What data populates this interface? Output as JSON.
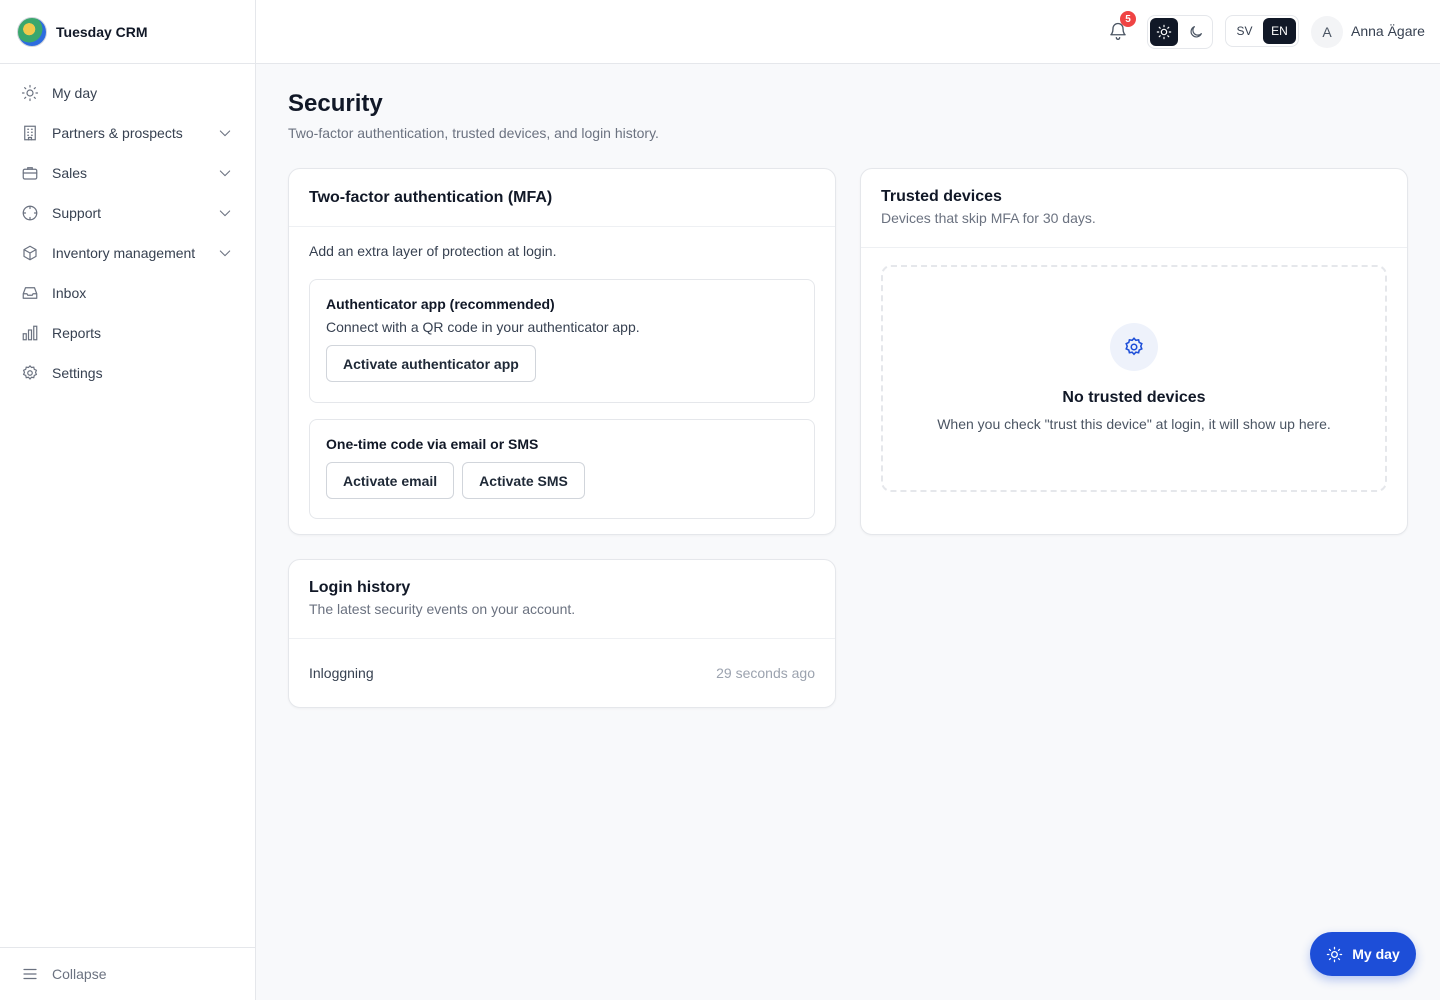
{
  "app": {
    "name": "Tuesday CRM"
  },
  "sidebar": {
    "items": [
      {
        "label": "My day",
        "icon": "sun-icon",
        "expandable": false
      },
      {
        "label": "Partners & prospects",
        "icon": "building-icon",
        "expandable": true
      },
      {
        "label": "Sales",
        "icon": "briefcase-icon",
        "expandable": true
      },
      {
        "label": "Support",
        "icon": "lifebuoy-icon",
        "expandable": true
      },
      {
        "label": "Inventory management",
        "icon": "box-icon",
        "expandable": true
      },
      {
        "label": "Inbox",
        "icon": "inbox-icon",
        "expandable": false
      },
      {
        "label": "Reports",
        "icon": "bar-chart-icon",
        "expandable": false
      },
      {
        "label": "Settings",
        "icon": "gear-icon",
        "expandable": false
      }
    ],
    "collapse_label": "Collapse"
  },
  "header": {
    "notification_count": "5",
    "theme": {
      "active": "light"
    },
    "languages": [
      "SV",
      "EN"
    ],
    "active_language": "EN",
    "avatar_initial": "A",
    "user_name": "Anna Ägare"
  },
  "page": {
    "title": "Security",
    "subtitle": "Two-factor authentication, trusted devices, and login history."
  },
  "mfa": {
    "title": "Two-factor authentication (MFA)",
    "intro": "Add an extra layer of protection at login.",
    "authenticator": {
      "title": "Authenticator app (recommended)",
      "description": "Connect with a QR code in your authenticator app.",
      "button": "Activate authenticator app"
    },
    "otp": {
      "title": "One-time code via email or SMS",
      "email_button": "Activate email",
      "sms_button": "Activate SMS"
    }
  },
  "trusted": {
    "title": "Trusted devices",
    "description": "Devices that skip MFA for 30 days.",
    "empty_title": "No trusted devices",
    "empty_desc": "When you check \"trust this device\" at login, it will show up here."
  },
  "history": {
    "title": "Login history",
    "description": "The latest security events on your account.",
    "rows": [
      {
        "event": "Inloggning",
        "time": "29 seconds ago"
      }
    ]
  },
  "fab": {
    "label": "My day"
  },
  "colors": {
    "accent": "#1d4ed8",
    "badge": "#ef4444",
    "dark": "#111827"
  }
}
